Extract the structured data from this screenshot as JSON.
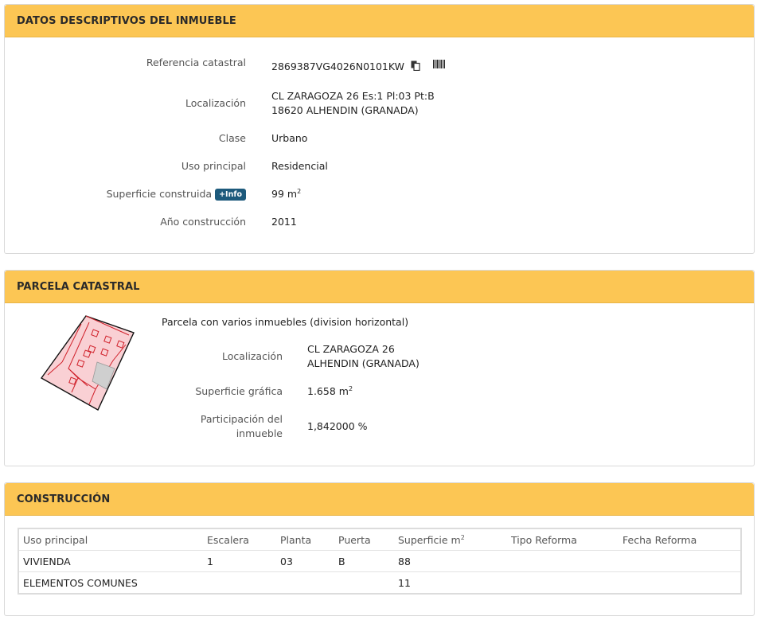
{
  "datos": {
    "title": "DATOS DESCRIPTIVOS DEL INMUEBLE",
    "ref_label": "Referencia catastral",
    "ref_value": "2869387VG4026N0101KW",
    "loc_label": "Localización",
    "loc_line1": "CL ZARAGOZA 26 Es:1 Pl:03 Pt:B",
    "loc_line2": "18620 ALHENDIN (GRANADA)",
    "clase_label": "Clase",
    "clase_value": "Urbano",
    "uso_label": "Uso principal",
    "uso_value": "Residencial",
    "sup_label": "Superficie construida",
    "info_badge": "+Info",
    "sup_value": "99 m",
    "sup_exp": "2",
    "anio_label": "Año construcción",
    "anio_value": "2011"
  },
  "parcela": {
    "title": "PARCELA CATASTRAL",
    "desc": "Parcela con varios inmuebles (division horizontal)",
    "loc_label": "Localización",
    "loc_line1": "CL ZARAGOZA 26",
    "loc_line2": "ALHENDIN (GRANADA)",
    "supg_label": "Superficie gráfica",
    "supg_value": "1.658 m",
    "supg_exp": "2",
    "part_label_1": "Participación del",
    "part_label_2": "inmueble",
    "part_value": "1,842000 %"
  },
  "construccion": {
    "title": "CONSTRUCCIÓN",
    "headers": {
      "uso": "Uso principal",
      "escalera": "Escalera",
      "planta": "Planta",
      "puerta": "Puerta",
      "superficie": "Superficie m",
      "superficie_exp": "2",
      "tipo": "Tipo Reforma",
      "fecha": "Fecha Reforma"
    },
    "rows": [
      {
        "uso": "VIVIENDA",
        "escalera": "1",
        "planta": "03",
        "puerta": "B",
        "superficie": "88",
        "tipo": "",
        "fecha": ""
      },
      {
        "uso": "ELEMENTOS COMUNES",
        "escalera": "",
        "planta": "",
        "puerta": "",
        "superficie": "11",
        "tipo": "",
        "fecha": ""
      }
    ]
  },
  "colors": {
    "header_bg": "#fcc654",
    "badge_bg": "#1d5a7c",
    "parcel_fill": "#f7c7cc",
    "parcel_line": "#d0202a"
  },
  "icons": {
    "copy": "copy-icon",
    "barcode": "barcode-icon"
  }
}
